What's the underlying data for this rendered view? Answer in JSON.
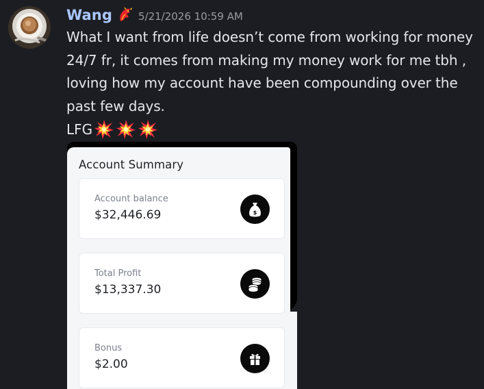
{
  "message": {
    "author": "Wang",
    "timestamp": "5/21/2026 10:59 AM",
    "text": "What I want from life doesn’t come from working for money\n24/7 fr, it comes from making my money work for me tbh ,\nloving how my account have been compounding over the\npast few days.",
    "lfg": "LFG",
    "author_badge_icon": "dragon-icon",
    "emoji_icons": [
      "explosion-emoji-icon",
      "explosion-emoji-icon",
      "explosion-emoji-icon"
    ]
  },
  "attachment": {
    "title": "Account Summary",
    "cards": [
      {
        "label": "Account balance",
        "value": "$32,446.69",
        "icon": "money-bag-icon"
      },
      {
        "label": "Total Profit",
        "value": "$13,337.30",
        "icon": "coin-stack-icon"
      },
      {
        "label": "Bonus",
        "value": "$2.00",
        "icon": "gift-icon"
      }
    ]
  },
  "colors": {
    "background": "#1c1d22",
    "username": "#a9c6ff",
    "timestamp": "#9b9ca3",
    "message_text": "#e6e7ea",
    "panel": "#f5f6f8",
    "card": "#ffffff",
    "icon_circle": "#0a0a0a"
  }
}
